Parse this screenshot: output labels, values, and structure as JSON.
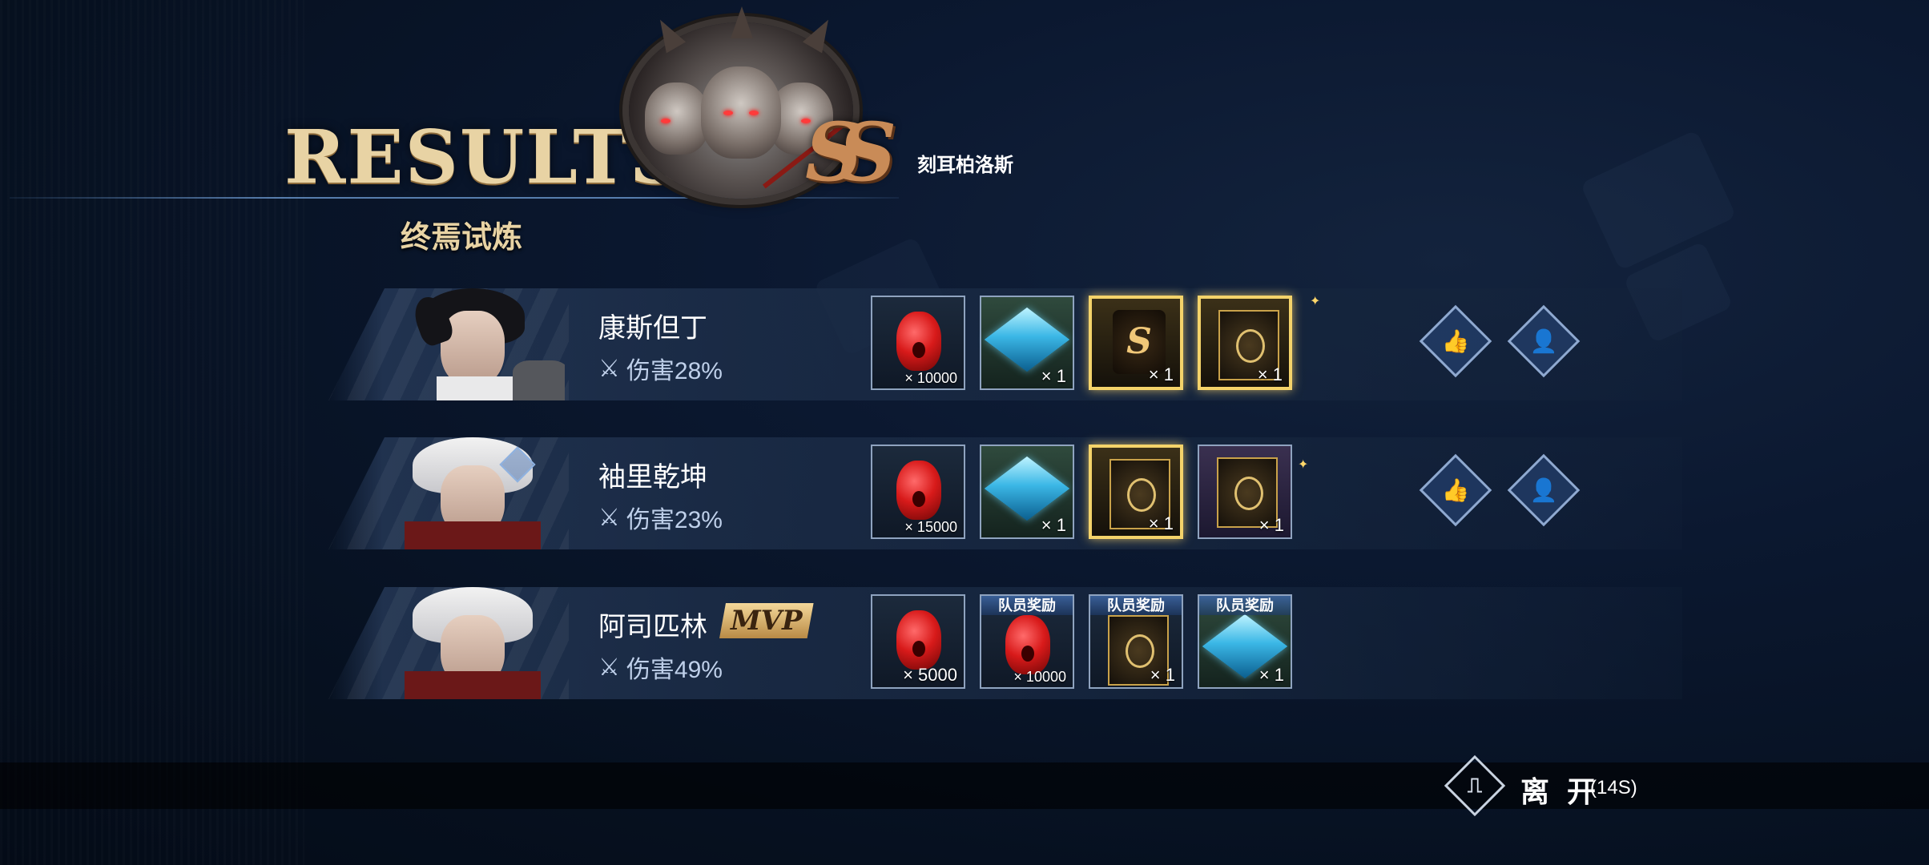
{
  "header": {
    "title": "RESULTS",
    "subtitle": "终焉试炼",
    "boss_name": "刻耳柏洛斯",
    "rank": "SS"
  },
  "players": [
    {
      "name": "康斯但丁",
      "damage": "伤害28%",
      "mvp": "",
      "rewards": [
        {
          "icon": "red-gem-icon",
          "qty": "× 10000"
        },
        {
          "icon": "blue-crystal-icon",
          "qty": "× 1"
        },
        {
          "icon": "ss-emblem-icon",
          "qty": "× 1",
          "highlight": true
        },
        {
          "icon": "gold-card-icon",
          "qty": "× 1",
          "highlight": true
        }
      ]
    },
    {
      "name": "袖里乾坤",
      "damage": "伤害23%",
      "mvp": "",
      "rewards": [
        {
          "icon": "red-gem-icon",
          "qty": "× 15000"
        },
        {
          "icon": "blue-crystal-icon",
          "qty": "× 1"
        },
        {
          "icon": "gold-card-icon",
          "qty": "× 1",
          "highlight": true
        },
        {
          "icon": "gold-card-icon",
          "qty": "× 1"
        }
      ]
    },
    {
      "name": "阿司匹林",
      "damage": "伤害49%",
      "mvp": "MVP",
      "rewards": [
        {
          "icon": "red-gem-icon",
          "qty": "× 5000"
        },
        {
          "icon": "red-gem-icon",
          "qty": "× 10000",
          "tag": "队员奖励"
        },
        {
          "icon": "gold-card-icon",
          "qty": "× 1",
          "tag": "队员奖励"
        },
        {
          "icon": "blue-crystal-icon",
          "qty": "× 1",
          "tag": "队员奖励"
        }
      ]
    }
  ],
  "footer": {
    "leave_label": "离 开",
    "timer": "(14S)"
  },
  "colors": {
    "gold": "#e8d3a4",
    "highlight": "#f4d36a",
    "accent_blue": "#7fb0ff"
  }
}
